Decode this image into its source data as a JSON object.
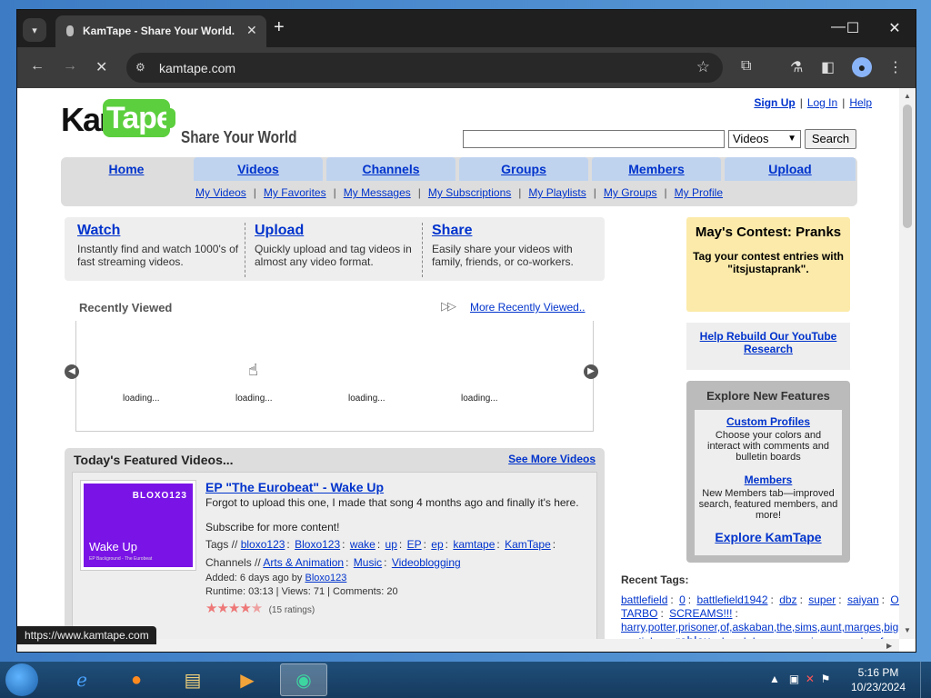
{
  "browser": {
    "tab_title": "KamTape - Share Your World.",
    "url": "kamtape.com",
    "status_url": "https://www.kamtape.com"
  },
  "header": {
    "logo_kam": "Kam",
    "logo_tape": "Tape",
    "slogan": "Share Your World",
    "sign_up": "Sign Up",
    "log_in": "Log In",
    "help": "Help",
    "search_value": "",
    "search_category": "Videos",
    "search_button": "Search"
  },
  "nav": {
    "tabs": [
      "Home",
      "Videos",
      "Channels",
      "Groups",
      "Members",
      "Upload"
    ],
    "subnav": [
      "My Videos",
      "My Favorites",
      "My Messages",
      "My Subscriptions",
      "My Playlists",
      "My Groups",
      "My Profile"
    ]
  },
  "intro": [
    {
      "title": "Watch",
      "desc": "Instantly find and watch 1000's of fast streaming videos."
    },
    {
      "title": "Upload",
      "desc": "Quickly upload and tag videos in almost any video format."
    },
    {
      "title": "Share",
      "desc": "Easily share your videos with family, friends, or co-workers."
    }
  ],
  "recent": {
    "title": "Recently Viewed",
    "more": "More Recently Viewed..",
    "loading": [
      "loading...",
      "loading...",
      "loading...",
      "loading..."
    ]
  },
  "featured": {
    "title": "Today's Featured Videos...",
    "more": "See More Videos",
    "thumb_logo": "BLOXO123",
    "thumb_title": "Wake Up",
    "thumb_sub": "EP Background - The Eurobeat",
    "video_title": "EP \"The Eurobeat\" - Wake Up",
    "desc": "Forgot to upload this one, I made that song 4 months ago and finally it's here.",
    "subscribe": "Subscribe for more content!",
    "tags_label": "Tags //",
    "tags": [
      "bloxo123",
      "Bloxo123",
      "wake",
      "up",
      "EP",
      "ep",
      "kamtape",
      "KamTape"
    ],
    "channels_label": "Channels //",
    "channels": [
      "Arts & Animation",
      "Music",
      "Videoblogging"
    ],
    "added_label": "Added: 6 days ago by",
    "added_by": "Bloxo123",
    "runtime": "Runtime: 03:13 | Views: 71 | Comments: 20",
    "rating": 4.5,
    "ratings_count": "(15 ratings)"
  },
  "sidebar": {
    "contest_title": "May's Contest: Pranks",
    "contest_desc": "Tag your contest entries with \"itsjustaprank\".",
    "rebuild": "Help Rebuild Our YouTube Research",
    "explore_title": "Explore New Features",
    "features": [
      {
        "title": "Custom Profiles",
        "desc": "Choose your colors and interact with comments and bulletin boards"
      },
      {
        "title": "Members",
        "desc": "New Members tab—improved search, featured members, and more!"
      }
    ],
    "explore_link": "Explore KamTape",
    "recent_tags_title": "Recent Tags:",
    "recent_tags_line1": [
      "battlefield",
      "0",
      "battlefield1942",
      "dbz",
      "super",
      "saiyan",
      "OMG"
    ],
    "recent_tags_line2": [
      "TARBO",
      "SCREAMS!!!"
    ],
    "recent_tags_line3": "harry,potter,prisoner,of,askaban,the,sims,aunt,marges,big,",
    "recent_tags_line4": [
      "austinlev",
      "roblox",
      "breakdance",
      "music",
      "comedy",
      "funny"
    ]
  },
  "taskbar": {
    "time": "5:16 PM",
    "date": "10/23/2024"
  },
  "colors": {
    "nav_tab": "#bfd3ef",
    "link": "#0033cc",
    "contest_bg": "#fbeaa9",
    "logo_green": "#5ccf3e"
  }
}
